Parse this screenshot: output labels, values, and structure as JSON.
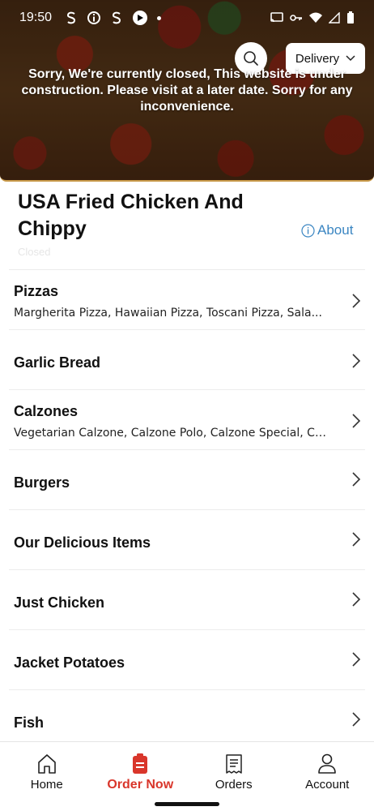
{
  "status_bar": {
    "time": "19:50"
  },
  "header": {
    "delivery_mode": "Delivery",
    "closed_message": "Sorry, We're currently closed, This website is under construction. Please visit at a later date. Sorry for any inconvenience."
  },
  "restaurant": {
    "name": "USA Fried Chicken And Chippy",
    "about_label": "About",
    "status_tag": "Closed"
  },
  "categories": [
    {
      "title": "Pizzas",
      "subtitle": "Margherita Pizza, Hawaiian Pizza, Toscani Pizza, Sala..."
    },
    {
      "title": "Garlic Bread",
      "subtitle": ""
    },
    {
      "title": "Calzones",
      "subtitle": "Vegetarian Calzone, Calzone Polo, Calzone Special, Ca..."
    },
    {
      "title": "Burgers",
      "subtitle": ""
    },
    {
      "title": "Our Delicious Items",
      "subtitle": ""
    },
    {
      "title": "Just Chicken",
      "subtitle": ""
    },
    {
      "title": "Jacket Potatoes",
      "subtitle": ""
    },
    {
      "title": "Fish",
      "subtitle": ""
    }
  ],
  "bottom_nav": [
    {
      "label": "Home",
      "icon": "home-icon",
      "active": false
    },
    {
      "label": "Order Now",
      "icon": "order-icon",
      "active": true
    },
    {
      "label": "Orders",
      "icon": "receipt-icon",
      "active": false
    },
    {
      "label": "Account",
      "icon": "user-icon",
      "active": false
    }
  ],
  "colors": {
    "accent": "#d9362b",
    "link": "#3b86c2"
  }
}
